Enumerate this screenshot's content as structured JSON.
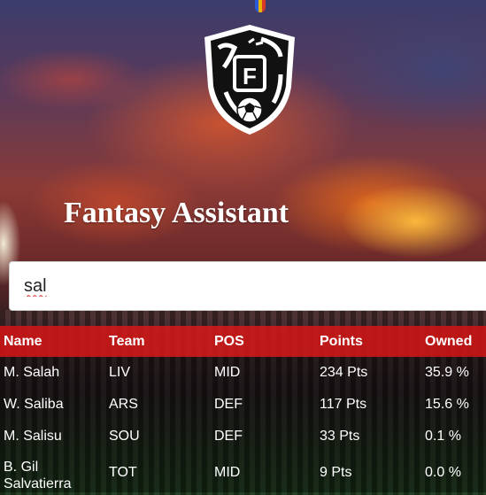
{
  "app": {
    "title": "Fantasy Assistant",
    "logo_letter": "F",
    "accent_color": "#d41a1a"
  },
  "search": {
    "value": "sal",
    "placeholder": ""
  },
  "results": {
    "columns": [
      "Name",
      "Team",
      "POS",
      "Points",
      "Owned"
    ],
    "rows": [
      {
        "name": "M. Salah",
        "team": "LIV",
        "pos": "MID",
        "points": "234 Pts",
        "owned": "35.9 %"
      },
      {
        "name": "W. Saliba",
        "team": "ARS",
        "pos": "DEF",
        "points": "117 Pts",
        "owned": "15.6 %"
      },
      {
        "name": "M. Salisu",
        "team": "SOU",
        "pos": "DEF",
        "points": "33 Pts",
        "owned": "0.1 %"
      },
      {
        "name": "B. Gil Salvatierra",
        "team": "TOT",
        "pos": "MID",
        "points": "9 Pts",
        "owned": "0.0 %"
      }
    ]
  }
}
